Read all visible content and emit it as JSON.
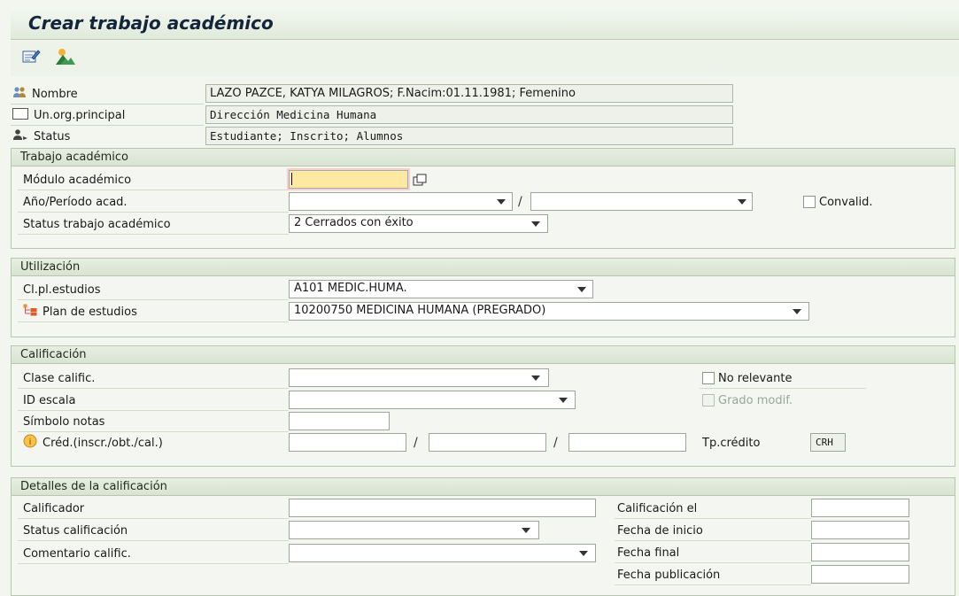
{
  "title": "Crear trabajo académico",
  "toolbar": {
    "icons": [
      "edit-note-icon",
      "overview-image-icon"
    ]
  },
  "header": {
    "nombre": {
      "label": "Nombre",
      "value": "LAZO PAZCE, KATYA MILAGROS; F.Nacim:01.11.1981; Femenino"
    },
    "unorg": {
      "label": "Un.org.principal",
      "value": "Dirección Medicina Humana"
    },
    "status": {
      "label": "Status",
      "value": "Estudiante; Inscrito; Alumnos"
    }
  },
  "trabajo": {
    "title": "Trabajo académico",
    "modulo_label": "Módulo académico",
    "modulo_value": "",
    "anio_label": "Año/Período acad.",
    "anio_value": "",
    "periodo_value": "",
    "slash": "/",
    "convalid_label": "Convalid.",
    "status_label": "Status trabajo académico",
    "status_value": "2 Cerrados con éxito"
  },
  "utilizacion": {
    "title": "Utilización",
    "clpl_label": "Cl.pl.estudios",
    "clpl_value": "A101 MEDIC.HUMA.",
    "plan_label": "Plan de estudios",
    "plan_value": "10200750 MEDICINA HUMANA (PREGRADO)"
  },
  "calificacion": {
    "title": "Calificación",
    "clase_label": "Clase calific.",
    "no_relevante_label": "No relevante",
    "id_escala_label": "ID escala",
    "grado_modif_label": "Grado modif.",
    "simbolo_label": "Símbolo notas",
    "cred_label": "Créd.(inscr./obt./cal.)",
    "slash": "/",
    "tp_credito_label": "Tp.crédito",
    "tp_credito_value": "CRH"
  },
  "detalles": {
    "title": "Detalles de la calificación",
    "calificador_label": "Calificador",
    "status_label": "Status calificación",
    "comentario_label": "Comentario calific.",
    "calif_el_label": "Calificación el",
    "fecha_inicio_label": "Fecha de inicio",
    "fecha_final_label": "Fecha final",
    "fecha_pub_label": "Fecha publicación"
  },
  "colors": {
    "background": "#f2f6ef",
    "group_header": "#dce7d6",
    "focus_field": "#fde9a2",
    "title_text": "#14243a"
  }
}
